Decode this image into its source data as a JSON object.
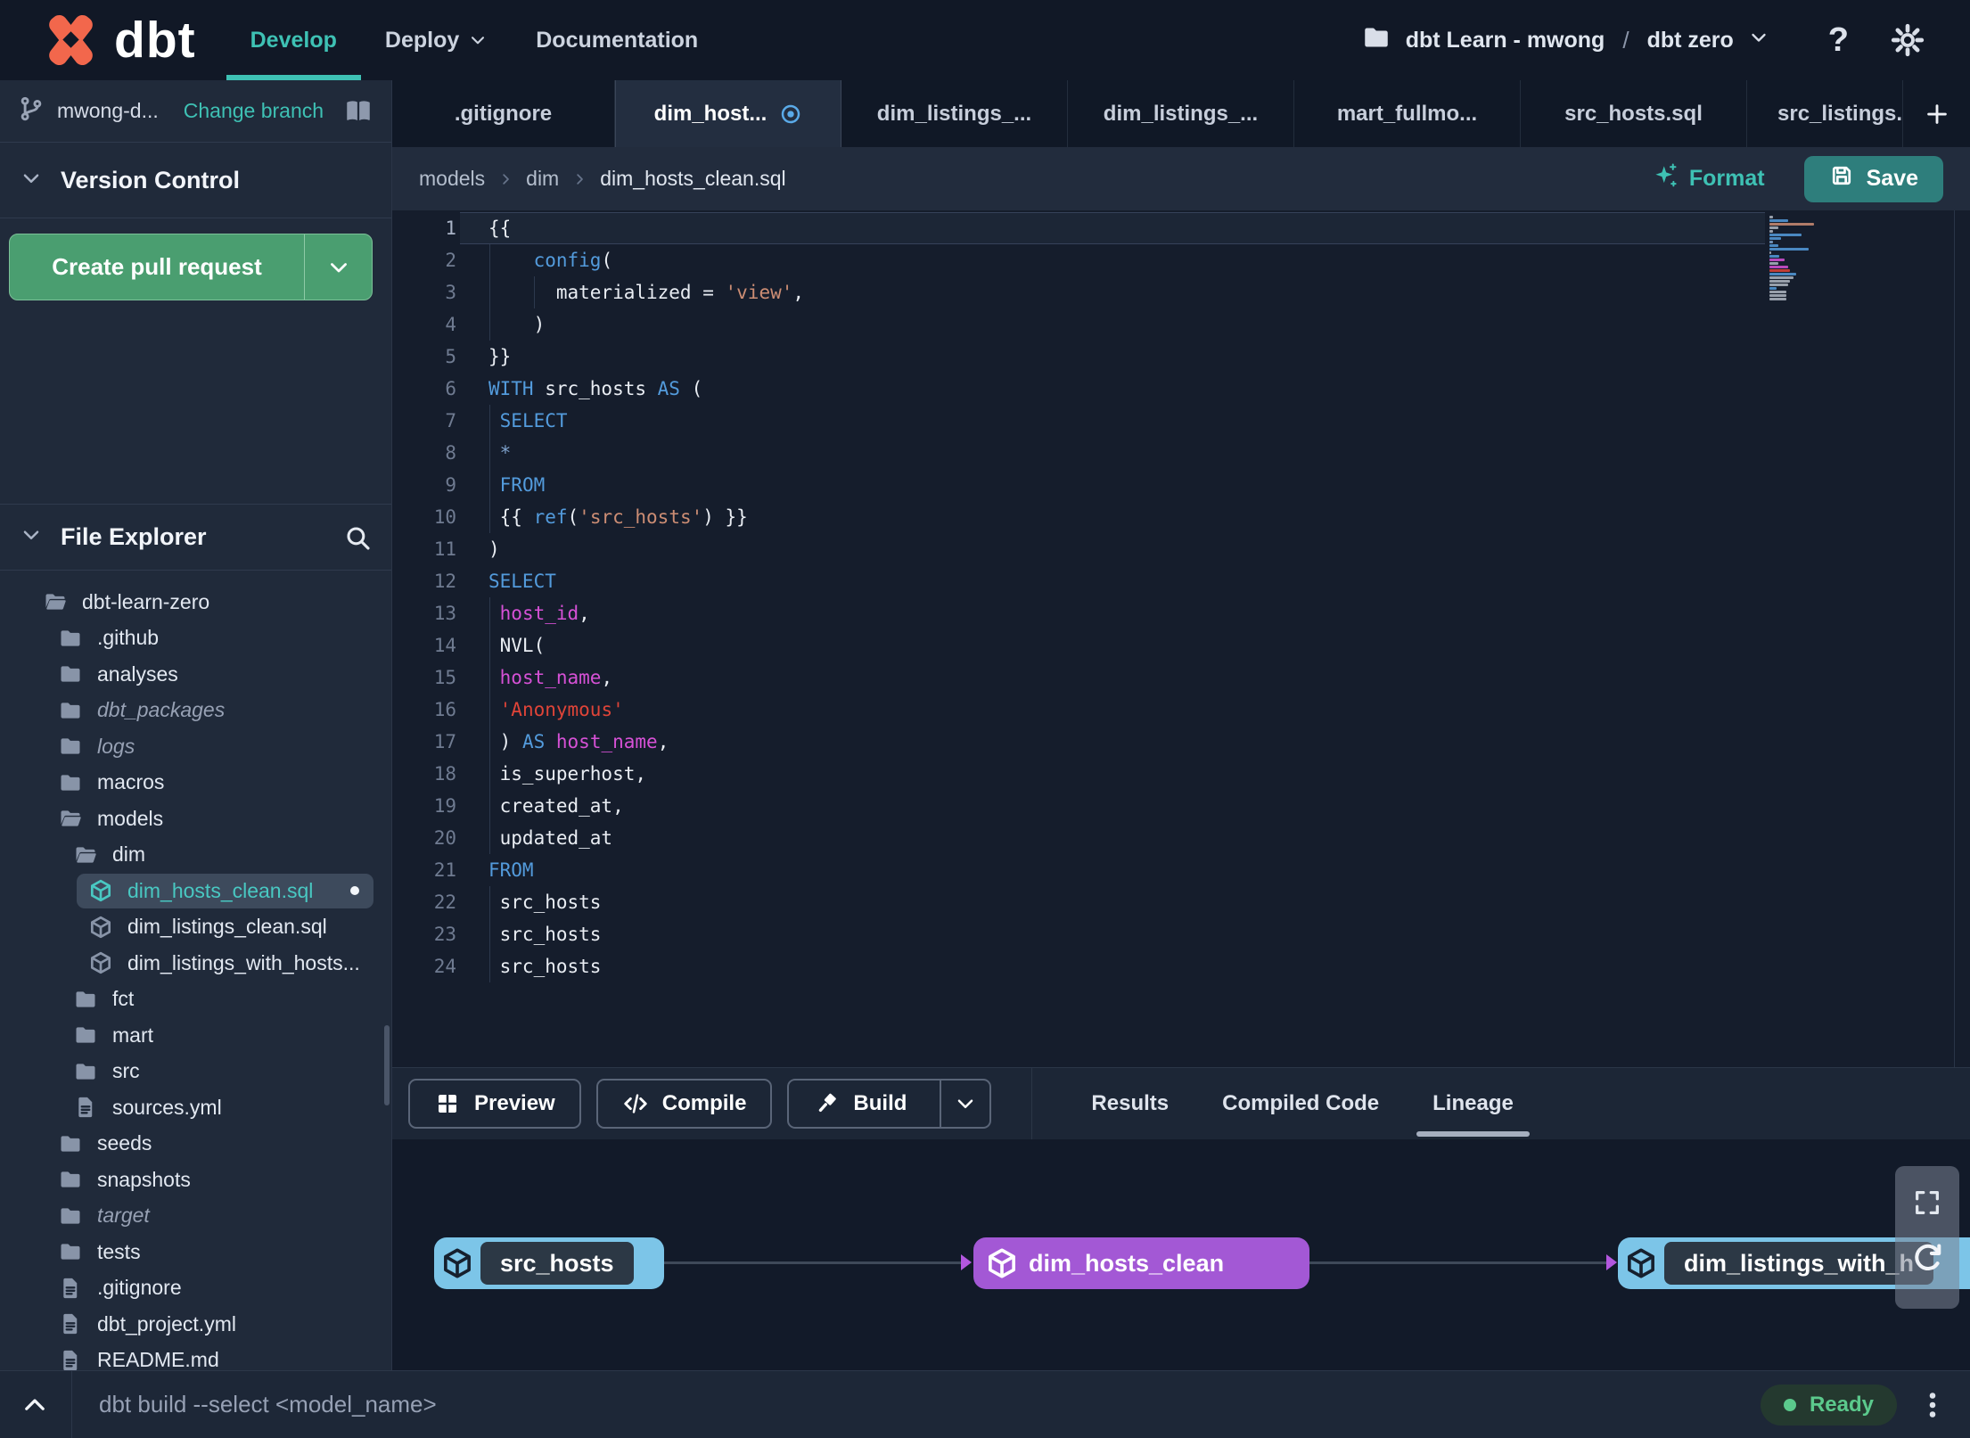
{
  "colors": {
    "accent_teal": "#3ec1b4",
    "brand_orange": "#f2674c",
    "pr_button_green": "#4a9e70",
    "save_button_teal": "#2e7e7c",
    "node_cyan": "#7cc5e8",
    "node_purple": "#a358d5",
    "ready_green": "#5bc98c",
    "tab_dirty_blue": "#5aaae8",
    "code_keyword": "#539bdc",
    "code_string": "#cc8d74",
    "code_string_red": "#df4438",
    "code_field": "#d651d6",
    "code_text": "#e9edf3"
  },
  "navbar": {
    "logo_text": "dbt",
    "items": [
      {
        "label": "Develop",
        "active": true,
        "chevron": false
      },
      {
        "label": "Deploy",
        "active": false,
        "chevron": true
      },
      {
        "label": "Documentation",
        "active": false,
        "chevron": false
      }
    ],
    "project_account": "dbt Learn - mwong",
    "project_separator": "/",
    "project_name": "dbt zero",
    "help_label": "?"
  },
  "sidebar": {
    "branch_name": "mwong-d...",
    "change_branch_label": "Change branch",
    "version_control_title": "Version Control",
    "create_pr_label": "Create pull request",
    "file_explorer_title": "File Explorer",
    "tree": [
      {
        "label": "dbt-learn-zero",
        "icon": "folder-open",
        "level": 0
      },
      {
        "label": ".github",
        "icon": "folder",
        "level": 1
      },
      {
        "label": "analyses",
        "icon": "folder",
        "level": 1
      },
      {
        "label": "dbt_packages",
        "icon": "folder",
        "level": 1,
        "italic": true
      },
      {
        "label": "logs",
        "icon": "folder",
        "level": 1,
        "italic": true
      },
      {
        "label": "macros",
        "icon": "folder",
        "level": 1
      },
      {
        "label": "models",
        "icon": "folder-open",
        "level": 1
      },
      {
        "label": "dim",
        "icon": "folder-open",
        "level": 2
      },
      {
        "label": "dim_hosts_clean.sql",
        "icon": "cube",
        "level": 3,
        "selected": true,
        "dirty": true
      },
      {
        "label": "dim_listings_clean.sql",
        "icon": "cube",
        "level": 3
      },
      {
        "label": "dim_listings_with_hosts...",
        "icon": "cube",
        "level": 3
      },
      {
        "label": "fct",
        "icon": "folder",
        "level": 2
      },
      {
        "label": "mart",
        "icon": "folder",
        "level": 2
      },
      {
        "label": "src",
        "icon": "folder",
        "level": 2
      },
      {
        "label": "sources.yml",
        "icon": "file",
        "level": 2
      },
      {
        "label": "seeds",
        "icon": "folder",
        "level": 1
      },
      {
        "label": "snapshots",
        "icon": "folder",
        "level": 1
      },
      {
        "label": "target",
        "icon": "folder",
        "level": 1,
        "italic": true
      },
      {
        "label": "tests",
        "icon": "folder",
        "level": 1
      },
      {
        "label": ".gitignore",
        "icon": "file",
        "level": 1
      },
      {
        "label": "dbt_project.yml",
        "icon": "file",
        "level": 1
      },
      {
        "label": "README.md",
        "icon": "file",
        "level": 1
      }
    ]
  },
  "tabs": {
    "items": [
      {
        "label": ".gitignore"
      },
      {
        "label": "dim_host...",
        "active": true,
        "dirty": true
      },
      {
        "label": "dim_listings_..."
      },
      {
        "label": "dim_listings_..."
      },
      {
        "label": "mart_fullmo..."
      },
      {
        "label": "src_hosts.sql"
      },
      {
        "label": "src_listings.",
        "clipped": true
      }
    ],
    "add_label": "+"
  },
  "breadcrumb": [
    "models",
    "dim",
    "dim_hosts_clean.sql"
  ],
  "editor_actions": {
    "format_label": "Format",
    "save_label": "Save"
  },
  "editor": {
    "active_line": 1,
    "lines": [
      {
        "n": 1,
        "t": [
          [
            "{{",
            "txt"
          ]
        ]
      },
      {
        "n": 2,
        "t": [
          [
            "    ",
            "txt"
          ],
          [
            "config",
            "kw"
          ],
          [
            "(",
            "txt"
          ]
        ]
      },
      {
        "n": 3,
        "t": [
          [
            "      materialized = ",
            "txt"
          ],
          [
            "'view'",
            "str"
          ],
          [
            ",",
            "txt"
          ]
        ]
      },
      {
        "n": 4,
        "t": [
          [
            "    )",
            "txt"
          ]
        ]
      },
      {
        "n": 5,
        "t": [
          [
            "}}",
            "txt"
          ]
        ]
      },
      {
        "n": 6,
        "t": [
          [
            "WITH",
            "kw"
          ],
          [
            " src_hosts ",
            "txt"
          ],
          [
            "AS",
            "kw"
          ],
          [
            " (",
            "txt"
          ]
        ]
      },
      {
        "n": 7,
        "t": [
          [
            " ",
            "txt"
          ],
          [
            "SELECT",
            "kw"
          ]
        ]
      },
      {
        "n": 8,
        "t": [
          [
            " ",
            "txt"
          ],
          [
            "*",
            "op"
          ]
        ]
      },
      {
        "n": 9,
        "t": [
          [
            " ",
            "txt"
          ],
          [
            "FROM",
            "kw"
          ]
        ]
      },
      {
        "n": 10,
        "t": [
          [
            " {{ ",
            "txt"
          ],
          [
            "ref",
            "kw"
          ],
          [
            "(",
            "txt"
          ],
          [
            "'src_hosts'",
            "str"
          ],
          [
            ") }}",
            "txt"
          ]
        ]
      },
      {
        "n": 11,
        "t": [
          [
            ")",
            "txt"
          ]
        ]
      },
      {
        "n": 12,
        "t": [
          [
            "SELECT",
            "kw"
          ]
        ]
      },
      {
        "n": 13,
        "t": [
          [
            " ",
            "txt"
          ],
          [
            "host_id",
            "mag"
          ],
          [
            ",",
            "txt"
          ]
        ]
      },
      {
        "n": 14,
        "t": [
          [
            " NVL(",
            "txt"
          ]
        ]
      },
      {
        "n": 15,
        "t": [
          [
            " ",
            "txt"
          ],
          [
            "host_name",
            "mag"
          ],
          [
            ",",
            "txt"
          ]
        ]
      },
      {
        "n": 16,
        "t": [
          [
            " ",
            "txt"
          ],
          [
            "'Anonymous'",
            "red"
          ]
        ]
      },
      {
        "n": 17,
        "t": [
          [
            " ) ",
            "txt"
          ],
          [
            "AS",
            "kw"
          ],
          [
            " ",
            "txt"
          ],
          [
            "host_name",
            "mag"
          ],
          [
            ",",
            "txt"
          ]
        ]
      },
      {
        "n": 18,
        "t": [
          [
            " is_superhost,",
            "txt"
          ]
        ]
      },
      {
        "n": 19,
        "t": [
          [
            " created_at,",
            "txt"
          ]
        ]
      },
      {
        "n": 20,
        "t": [
          [
            " updated_at",
            "txt"
          ]
        ]
      },
      {
        "n": 21,
        "t": [
          [
            "FROM",
            "kw"
          ]
        ]
      },
      {
        "n": 22,
        "t": [
          [
            " src_hosts",
            "txt"
          ]
        ]
      },
      {
        "n": 23,
        "t": [
          [
            " src_hosts",
            "txt"
          ]
        ]
      },
      {
        "n": 24,
        "t": [
          [
            " src_hosts",
            "txt"
          ]
        ]
      }
    ]
  },
  "bottom_panel": {
    "buttons": [
      {
        "label": "Preview",
        "icon": "grid"
      },
      {
        "label": "Compile",
        "icon": "code"
      },
      {
        "label": "Build",
        "icon": "hammer",
        "split": true
      }
    ],
    "tabs": [
      {
        "label": "Results"
      },
      {
        "label": "Compiled Code"
      },
      {
        "label": "Lineage",
        "active": true
      }
    ]
  },
  "lineage": {
    "nodes": [
      {
        "label": "src_hosts",
        "type": "source"
      },
      {
        "label": "dim_hosts_clean",
        "type": "selected"
      },
      {
        "label": "dim_listings_with_h",
        "type": "source"
      }
    ]
  },
  "statusbar": {
    "command": "dbt build --select <model_name>",
    "ready_label": "Ready"
  }
}
